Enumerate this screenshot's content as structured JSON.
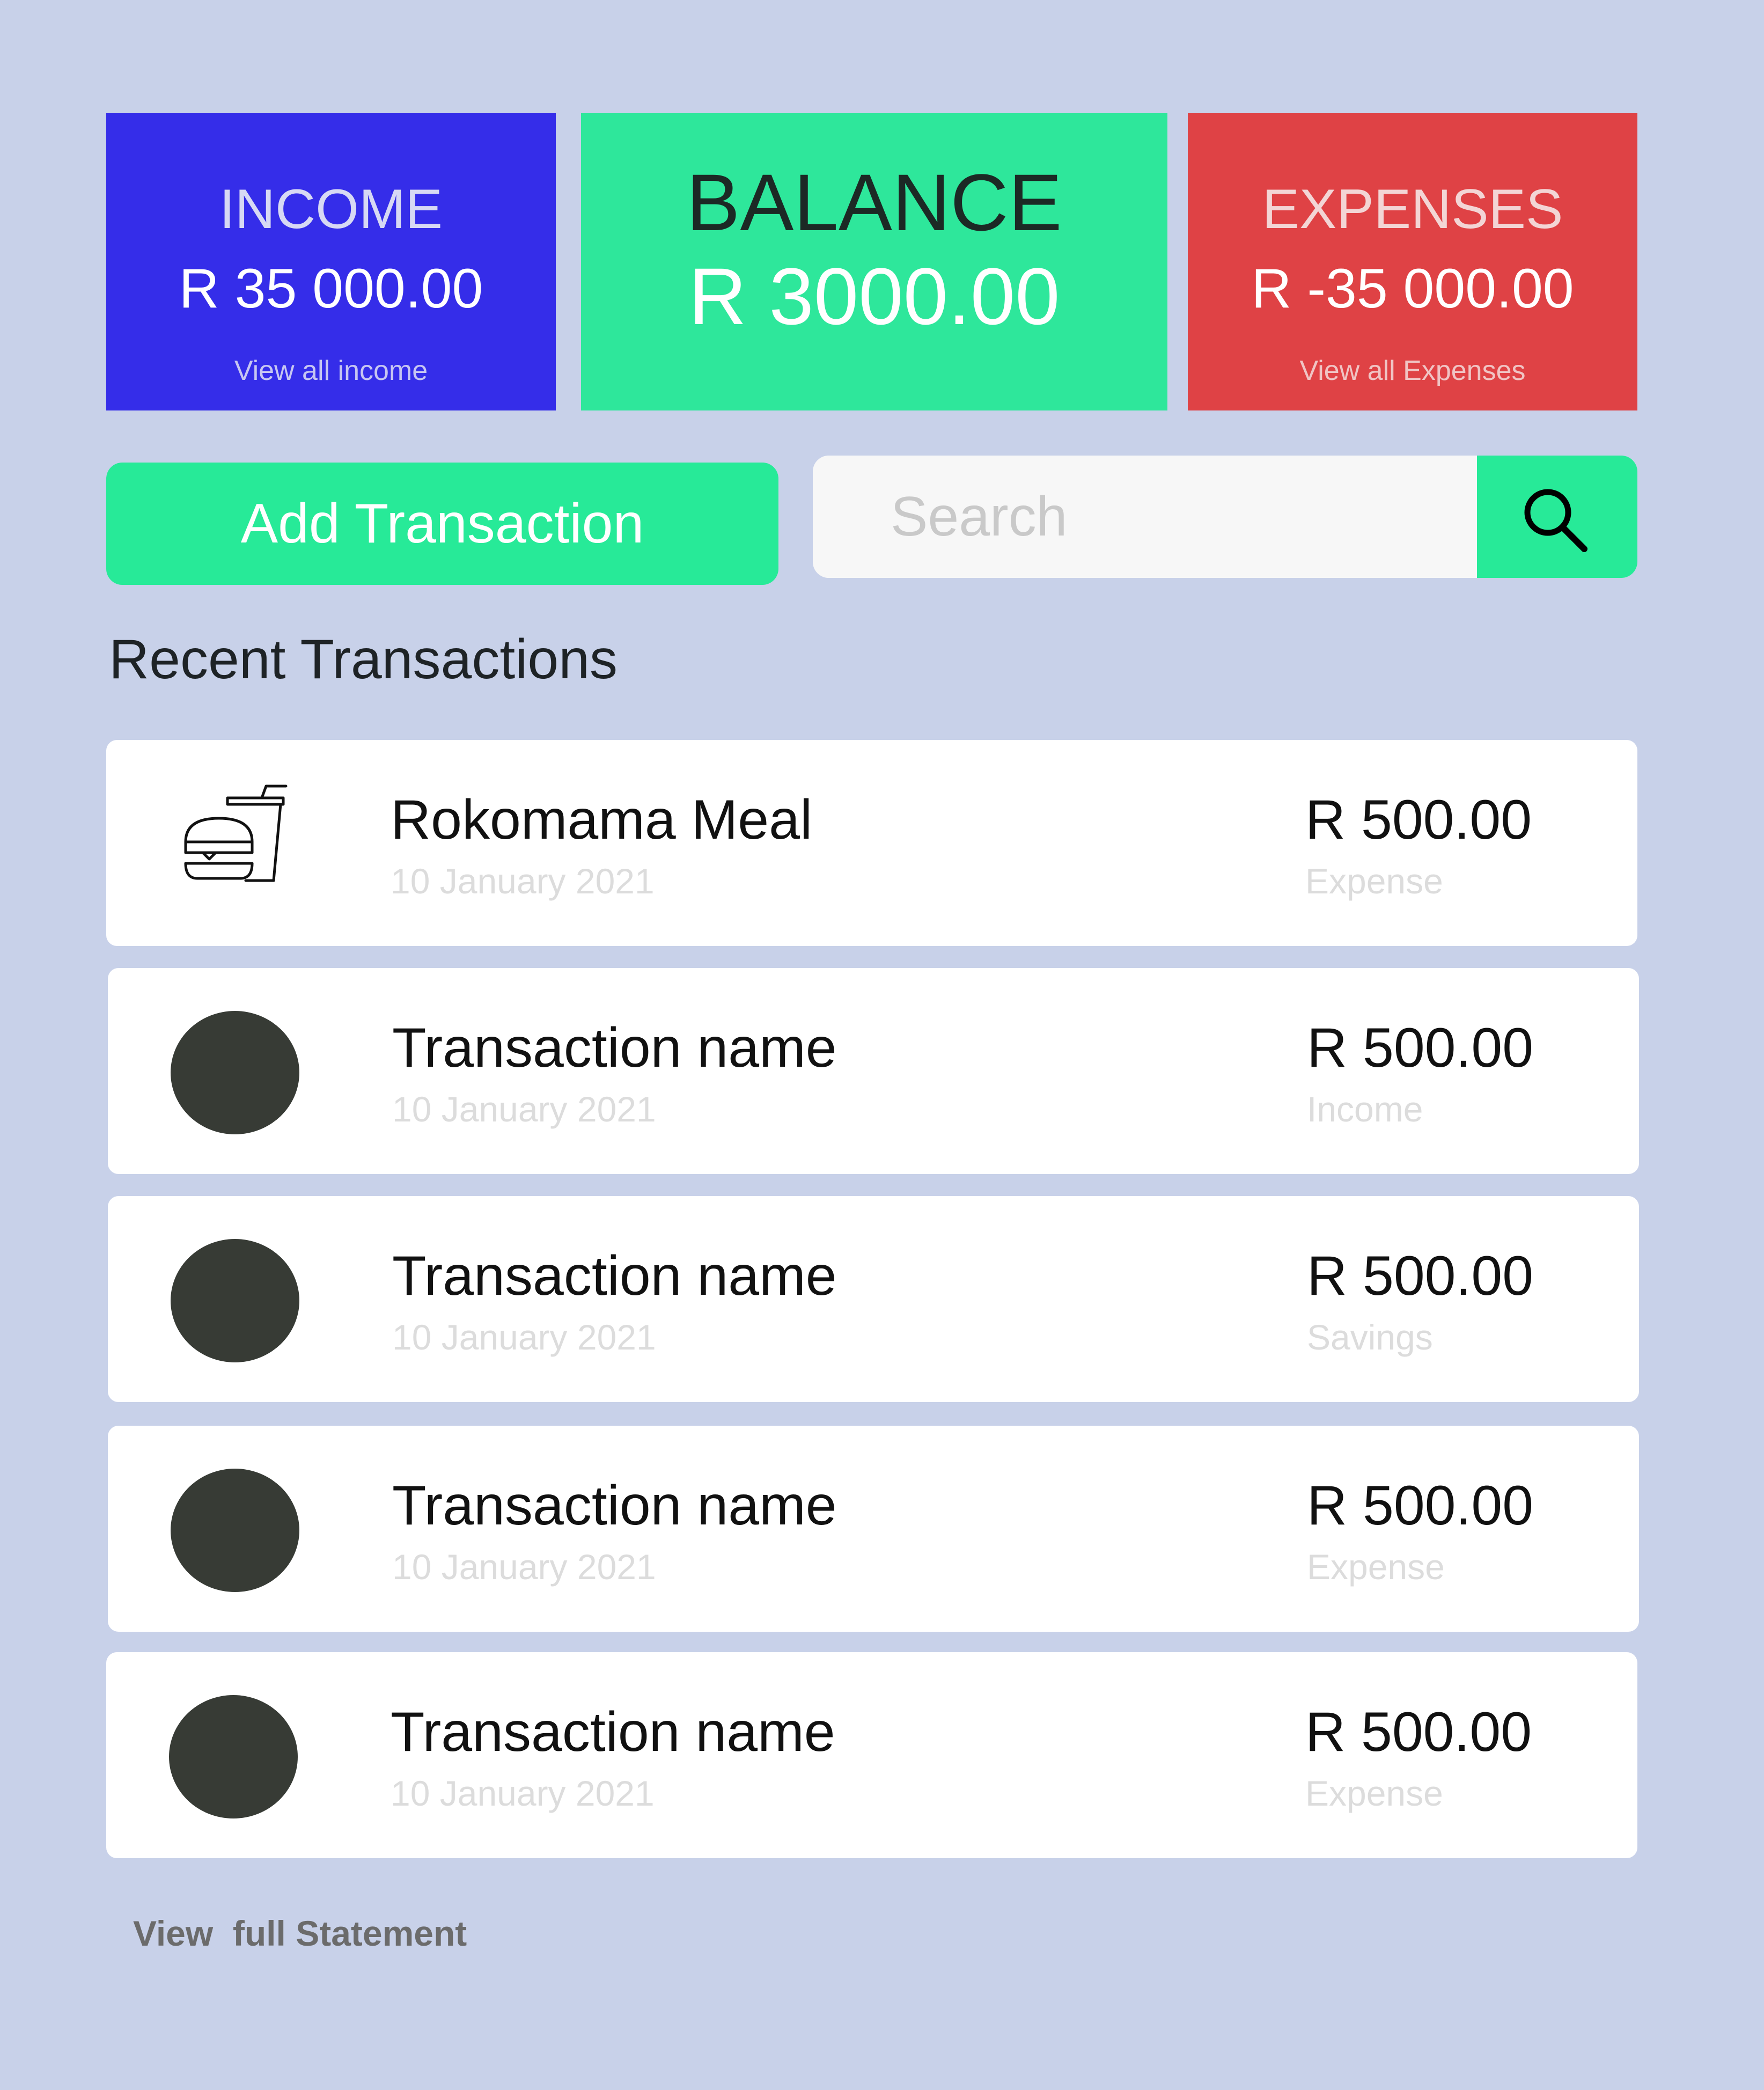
{
  "cards": {
    "income": {
      "label": "INCOME",
      "amount": "R 35 000.00",
      "link": "View all income",
      "color": "#352de9"
    },
    "balance": {
      "label": "BALANCE",
      "amount": "R 3000.00",
      "color": "#2ee79b"
    },
    "expenses": {
      "label": "EXPENSES",
      "amount": "R -35 000.00",
      "link": "View all Expenses",
      "color": "#df4245"
    }
  },
  "actions": {
    "add_label": "Add Transaction",
    "search_placeholder": "Search",
    "search_icon": "search-icon"
  },
  "section_title": "Recent Transactions",
  "transactions": [
    {
      "icon": "food-drink-icon",
      "name": "Rokomama Meal",
      "date": "10 January 2021",
      "amount": "R 500.00",
      "category": "Expense"
    },
    {
      "icon": "avatar-placeholder",
      "name": "Transaction name",
      "date": "10 January 2021",
      "amount": "R 500.00",
      "category": "Income"
    },
    {
      "icon": "avatar-placeholder",
      "name": "Transaction name",
      "date": "10 January 2021",
      "amount": "R 500.00",
      "category": "Savings"
    },
    {
      "icon": "avatar-placeholder",
      "name": "Transaction name",
      "date": "10 January 2021",
      "amount": "R 500.00",
      "category": "Expense"
    },
    {
      "icon": "avatar-placeholder",
      "name": "Transaction name",
      "date": "10 January 2021",
      "amount": "R 500.00",
      "category": "Expense"
    }
  ],
  "footer_link": "View  full Statement",
  "colors": {
    "background": "#c8d1e9",
    "accent_green": "#27ea98"
  }
}
